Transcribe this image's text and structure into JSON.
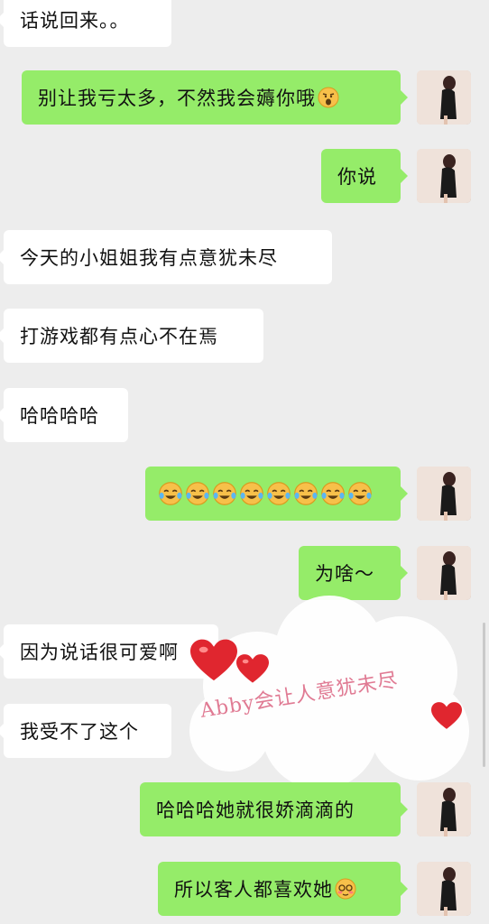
{
  "messages": [
    {
      "side": "in",
      "text": "话说回来。。"
    },
    {
      "side": "out",
      "text": "别让我亏太多，不然我会薅你哦",
      "emoji": "shocked-face"
    },
    {
      "side": "out",
      "text": "你说"
    },
    {
      "side": "in",
      "text": "今天的小姐姐我有点意犹未尽"
    },
    {
      "side": "in",
      "text": "打游戏都有点心不在焉"
    },
    {
      "side": "in",
      "text": "哈哈哈哈"
    },
    {
      "side": "out",
      "text": "",
      "emoji": "tears-of-joy-face",
      "emoji_count": 8
    },
    {
      "side": "out",
      "text": "为啥～"
    },
    {
      "side": "in",
      "text": "因为说话很可爱啊"
    },
    {
      "side": "in",
      "text": "我受不了这个"
    },
    {
      "side": "out",
      "text": "哈哈哈她就很娇滴滴的"
    },
    {
      "side": "out",
      "text": "所以客人都喜欢她",
      "emoji": "blushing-face"
    }
  ],
  "sticker": {
    "text": "Abby会让人意犹未尽",
    "color": "#e07a93"
  },
  "colors": {
    "background": "#ededed",
    "incoming": "#ffffff",
    "outgoing": "#95ec69",
    "heart": "#e0262f"
  }
}
